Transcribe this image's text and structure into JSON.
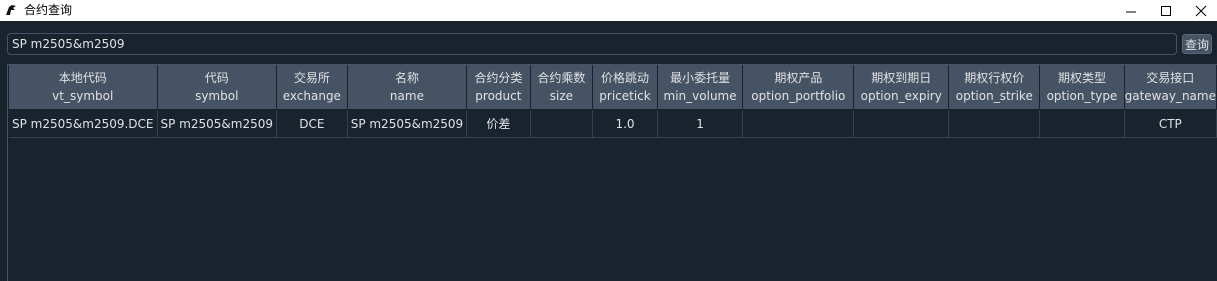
{
  "window": {
    "title": "合约查询"
  },
  "search": {
    "value": "SP m2505&m2509",
    "button_label": "查询"
  },
  "table": {
    "headers": [
      {
        "cn": "本地代码",
        "en": "vt_symbol"
      },
      {
        "cn": "代码",
        "en": "symbol"
      },
      {
        "cn": "交易所",
        "en": "exchange"
      },
      {
        "cn": "名称",
        "en": "name"
      },
      {
        "cn": "合约分类",
        "en": "product"
      },
      {
        "cn": "合约乘数",
        "en": "size"
      },
      {
        "cn": "价格跳动",
        "en": "pricetick"
      },
      {
        "cn": "最小委托量",
        "en": "min_volume"
      },
      {
        "cn": "期权产品",
        "en": "option_portfolio"
      },
      {
        "cn": "期权到期日",
        "en": "option_expiry"
      },
      {
        "cn": "期权行权价",
        "en": "option_strike"
      },
      {
        "cn": "期权类型",
        "en": "option_type"
      },
      {
        "cn": "交易接口",
        "en": "gateway_name"
      }
    ],
    "rows": [
      [
        "SP m2505&m2509.DCE",
        "SP m2505&m2509",
        "DCE",
        "SP m2505&m2509",
        "价差",
        "",
        "1.0",
        "1",
        "",
        "",
        "",
        "",
        "CTP"
      ]
    ]
  }
}
